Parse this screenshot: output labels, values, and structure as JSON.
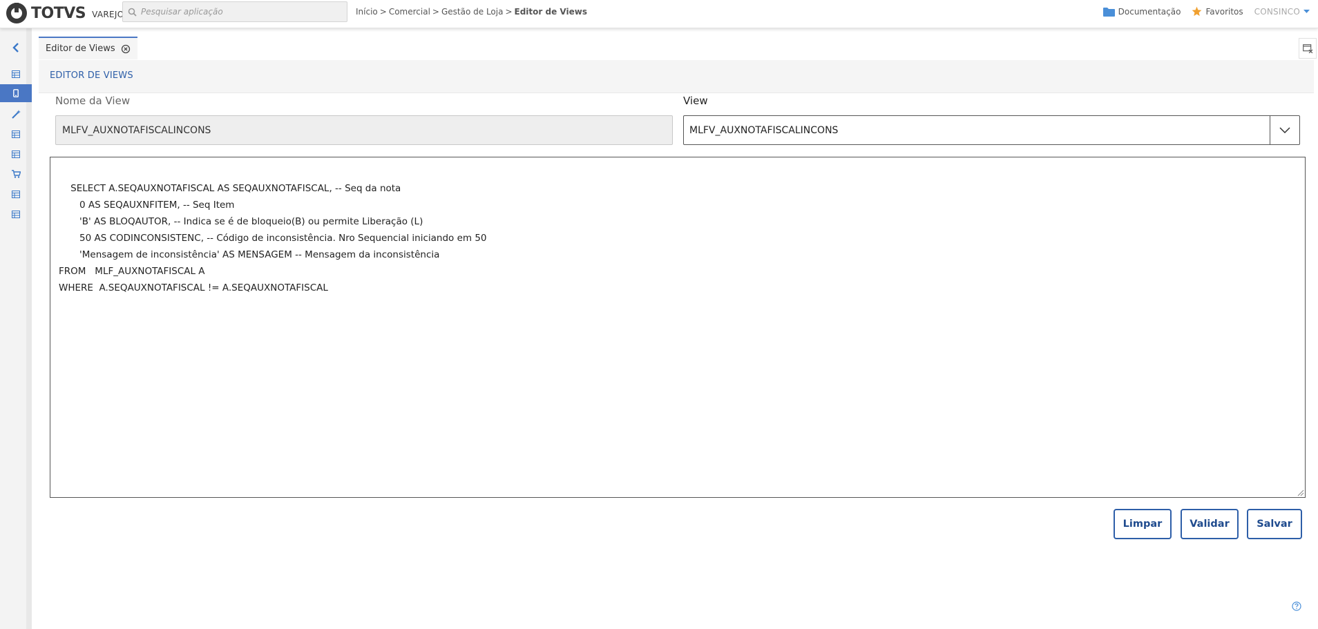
{
  "app": {
    "logo_text": "TOTVS",
    "logo_sub": "VAREJO"
  },
  "search": {
    "placeholder": "Pesquisar aplicação",
    "value": ""
  },
  "breadcrumb": {
    "items": [
      "Início",
      "Comercial",
      "Gestão de Loja"
    ],
    "separator": ">",
    "current": "Editor de Views"
  },
  "topright": {
    "documentacao": "Documentação",
    "favoritos": "Favoritos",
    "user": "CONSINCO"
  },
  "sidebar": {
    "items": [
      {
        "icon": "chevron-left-icon"
      },
      {
        "icon": "table-icon"
      },
      {
        "icon": "mobile-icon",
        "active": true
      },
      {
        "icon": "magic-wand-icon"
      },
      {
        "icon": "table-icon"
      },
      {
        "icon": "table-icon"
      },
      {
        "icon": "cart-icon"
      },
      {
        "icon": "table-icon"
      },
      {
        "icon": "table-icon"
      }
    ]
  },
  "tabs": [
    {
      "label": "Editor de Views",
      "active": true
    }
  ],
  "page": {
    "section_title": "EDITOR DE VIEWS",
    "nome_label": "Nome da View",
    "nome_value": "MLFV_AUXNOTAFISCALINCONS",
    "view_label": "View",
    "view_value": "MLFV_AUXNOTAFISCALINCONS",
    "sql": "SELECT A.SEQAUXNOTAFISCAL AS SEQAUXNOTAFISCAL, -- Seq da nota\n       0 AS SEQAUXNFITEM, -- Seq Item\n       'B' AS BLOQAUTOR, -- Indica se é de bloqueio(B) ou permite Liberação (L)\n       50 AS CODINCONSISTENC, -- Código de inconsistência. Nro Sequencial iniciando em 50\n       'Mensagem de inconsistência' AS MENSAGEM -- Mensagem da inconsistência\nFROM   MLF_AUXNOTAFISCAL A\nWHERE  A.SEQAUXNOTAFISCAL != A.SEQAUXNOTAFISCAL"
  },
  "buttons": {
    "limpar": "Limpar",
    "validar": "Validar",
    "salvar": "Salvar"
  },
  "colors": {
    "accent": "#2d5ea8",
    "sidebar_active": "#4a77c4",
    "favorite_star": "#f0a030",
    "doc_folder": "#4a8fd8"
  }
}
